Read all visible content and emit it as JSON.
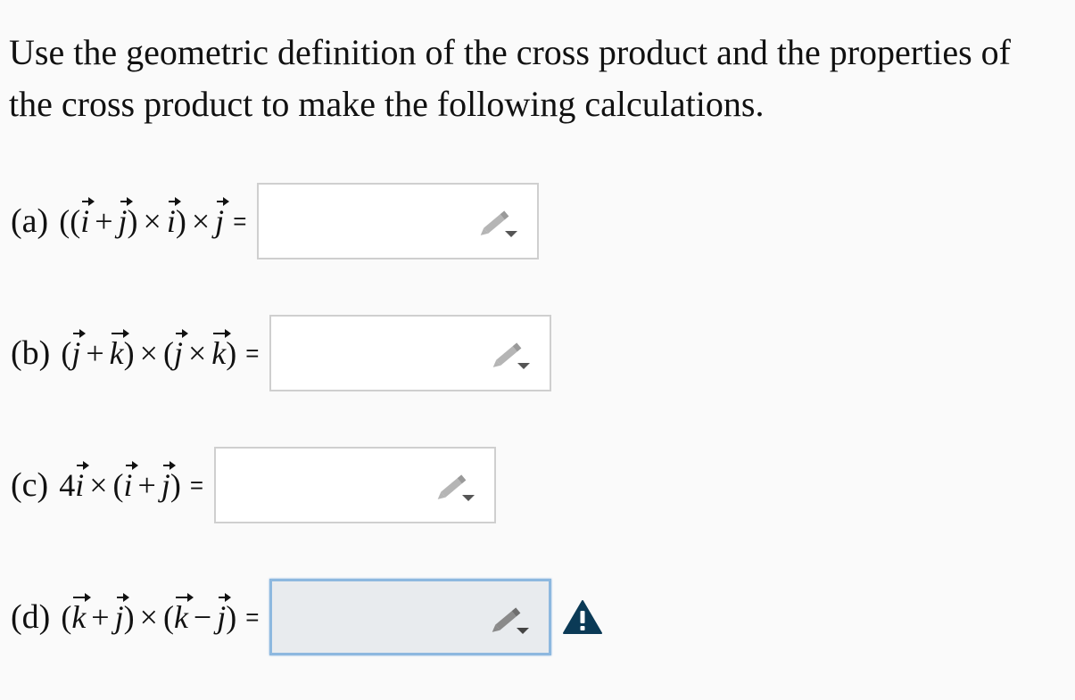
{
  "intro": {
    "line1": "Use the geometric definition of the cross product and the properties of",
    "line2": "the cross product to make the following calculations."
  },
  "problems": [
    {
      "label": "(a)",
      "equals": "=",
      "answer": "",
      "tokens": [
        "(",
        "(",
        "i",
        "+",
        "j",
        ")",
        "×",
        "i",
        ")",
        "×",
        "j"
      ]
    },
    {
      "label": "(b)",
      "equals": "=",
      "answer": "",
      "tokens": [
        "(",
        "j",
        "+",
        "k",
        ")",
        "×",
        "(",
        "j",
        "×",
        "k",
        ")"
      ]
    },
    {
      "label": "(c)",
      "equals": "=",
      "answer": "",
      "tokens": [
        "4",
        "i",
        "×",
        "(",
        "i",
        "+",
        "j",
        ")"
      ]
    },
    {
      "label": "(d)",
      "equals": "=",
      "answer": "",
      "tokens": [
        "(",
        "k",
        "+",
        "j",
        ")",
        "×",
        "(",
        "k",
        "−",
        "j",
        ")"
      ]
    }
  ],
  "icons": {
    "edit": "pencil-dropdown-icon",
    "warning": "warning-icon"
  },
  "colors": {
    "warning": "#0b3a56",
    "focus_border": "#8db8df",
    "focus_bg": "#e8ebee",
    "box_border": "#cfcfcf"
  }
}
